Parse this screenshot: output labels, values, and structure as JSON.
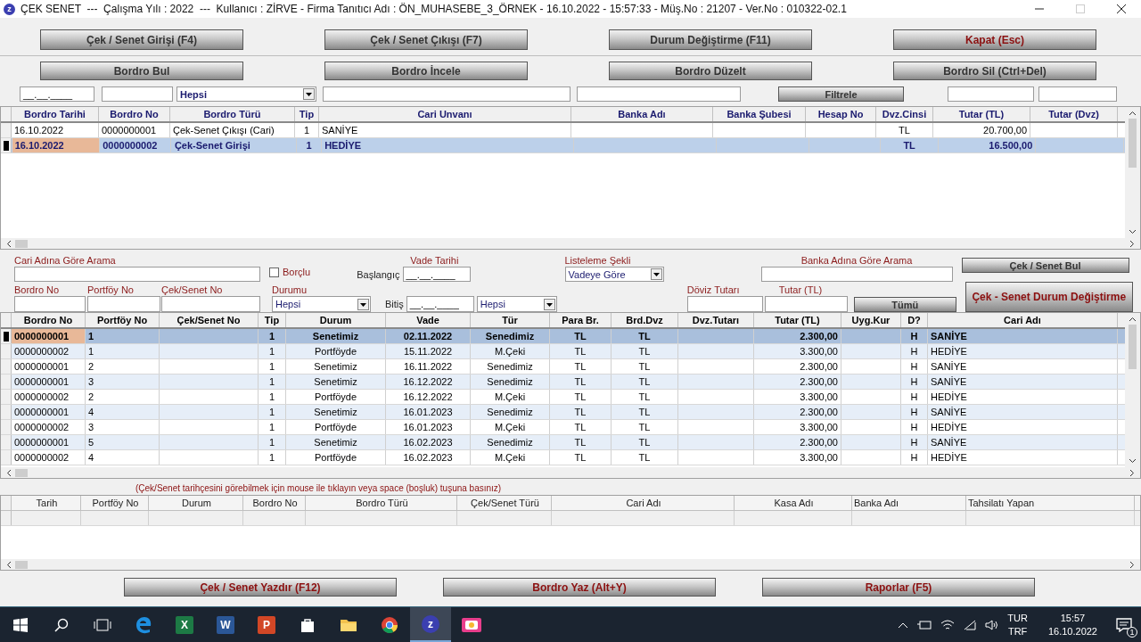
{
  "window": {
    "app_letter": "z",
    "title": "ÇEK SENET  ---  Çalışma Yılı : 2022  ---  Kullanıcı : ZİRVE - Firma Tanıtıcı Adı : ÖN_MUHASEBE_3_ÖRNEK - 16.10.2022 - 15:57:33 - Müş.No : 21207 - Ver.No : 010322-02.1"
  },
  "top_buttons": [
    {
      "label": "Çek / Senet Girişi (F4)",
      "kind": "normal"
    },
    {
      "label": "Çek / Senet Çıkışı (F7)",
      "kind": "normal"
    },
    {
      "label": "Durum Değiştirme (F11)",
      "kind": "normal"
    },
    {
      "label": "Kapat (Esc)",
      "kind": "danger"
    }
  ],
  "bordro_buttons": [
    "Bordro Bul",
    "Bordro İncele",
    "Bordro Düzelt",
    "Bordro Sil (Ctrl+Del)"
  ],
  "filter_bar": {
    "date_value": "__.__.____",
    "type_value": "Hepsi",
    "filter_button": "Filtrele"
  },
  "bordro_table": {
    "columns": [
      "Bordro Tarihi",
      "Bordro No",
      "Bordro Türü",
      "Tip",
      "Cari Unvanı",
      "Banka Adı",
      "Banka Şubesi",
      "Hesap No",
      "Dvz.Cinsi",
      "Tutar (TL)",
      "Tutar (Dvz)"
    ],
    "rows": [
      {
        "selected": false,
        "cells": [
          "16.10.2022",
          "0000000001",
          "Çek-Senet Çıkışı (Cari)",
          "1",
          "SANİYE",
          "",
          "",
          "",
          "TL",
          "20.700,00",
          ""
        ]
      },
      {
        "selected": true,
        "cells": [
          "16.10.2022",
          "0000000002",
          "Çek-Senet Girişi",
          "1",
          "HEDİYE",
          "",
          "",
          "",
          "TL",
          "16.500,00",
          ""
        ]
      }
    ]
  },
  "search": {
    "cari_label": "Cari Adına Göre Arama",
    "borclu_label": "Borçlu",
    "borclu_checked": false,
    "vade_label": "Vade Tarihi",
    "start_label": "Başlangıç",
    "start_value": "__.__.____",
    "end_label": "Bitiş",
    "end_value": "__.__.____",
    "end_select": "Hepsi",
    "listing_label": "Listeleme Şekli",
    "listing_value": "Vadeye Göre",
    "bank_label": "Banka Adına Göre Arama",
    "find_button": "Çek / Senet Bul",
    "bordro_no_label": "Bordro No",
    "portfoy_label": "Portföy No",
    "cek_no_label": "Çek/Senet No",
    "status_label": "Durumu",
    "status_value": "Hepsi",
    "doviz_label": "Döviz Tutarı",
    "tutar_label": "Tutar (TL)",
    "all_button": "Tümü",
    "change_button": "Çek - Senet Durum Değiştirme"
  },
  "cek_table": {
    "columns": [
      "Bordro No",
      "Portföy No",
      "Çek/Senet No",
      "Tip",
      "Durum",
      "Vade",
      "Tür",
      "Para Br.",
      "Brd.Dvz",
      "Dvz.Tutarı",
      "Tutar (TL)",
      "Uyg.Kur",
      "D?",
      "Cari Adı"
    ],
    "rows": [
      {
        "selected": true,
        "cells": [
          "0000000001",
          "1",
          "",
          "1",
          "Senetimiz",
          "02.11.2022",
          "Senedimiz",
          "TL",
          "TL",
          "",
          "2.300,00",
          "",
          "H",
          "SANİYE"
        ]
      },
      {
        "selected": false,
        "cells": [
          "0000000002",
          "1",
          "",
          "1",
          "Portföyde",
          "15.11.2022",
          "M.Çeki",
          "TL",
          "TL",
          "",
          "3.300,00",
          "",
          "H",
          "HEDİYE"
        ]
      },
      {
        "selected": false,
        "cells": [
          "0000000001",
          "2",
          "",
          "1",
          "Senetimiz",
          "16.11.2022",
          "Senedimiz",
          "TL",
          "TL",
          "",
          "2.300,00",
          "",
          "H",
          "SANİYE"
        ]
      },
      {
        "selected": false,
        "cells": [
          "0000000001",
          "3",
          "",
          "1",
          "Senetimiz",
          "16.12.2022",
          "Senedimiz",
          "TL",
          "TL",
          "",
          "2.300,00",
          "",
          "H",
          "SANİYE"
        ]
      },
      {
        "selected": false,
        "cells": [
          "0000000002",
          "2",
          "",
          "1",
          "Portföyde",
          "16.12.2022",
          "M.Çeki",
          "TL",
          "TL",
          "",
          "3.300,00",
          "",
          "H",
          "HEDİYE"
        ]
      },
      {
        "selected": false,
        "cells": [
          "0000000001",
          "4",
          "",
          "1",
          "Senetimiz",
          "16.01.2023",
          "Senedimiz",
          "TL",
          "TL",
          "",
          "2.300,00",
          "",
          "H",
          "SANİYE"
        ]
      },
      {
        "selected": false,
        "cells": [
          "0000000002",
          "3",
          "",
          "1",
          "Portföyde",
          "16.01.2023",
          "M.Çeki",
          "TL",
          "TL",
          "",
          "3.300,00",
          "",
          "H",
          "HEDİYE"
        ]
      },
      {
        "selected": false,
        "cells": [
          "0000000001",
          "5",
          "",
          "1",
          "Senetimiz",
          "16.02.2023",
          "Senedimiz",
          "TL",
          "TL",
          "",
          "2.300,00",
          "",
          "H",
          "SANİYE"
        ]
      },
      {
        "selected": false,
        "cells": [
          "0000000002",
          "4",
          "",
          "1",
          "Portföyde",
          "16.02.2023",
          "M.Çeki",
          "TL",
          "TL",
          "",
          "3.300,00",
          "",
          "H",
          "HEDİYE"
        ]
      }
    ]
  },
  "history_hint": "(Çek/Senet tarihçesini görebilmek için mouse ile tıklayın veya space (boşluk) tuşuna basınız)",
  "history_table": {
    "columns": [
      "Tarih",
      "Portföy No",
      "Durum",
      "Bordro No",
      "Bordro Türü",
      "Çek/Senet Türü",
      "Cari Adı",
      "Kasa Adı",
      "Banka Adı",
      "Tahsilatı Yapan"
    ]
  },
  "bottom_buttons": [
    "Çek / Senet Yazdır (F12)",
    "Bordro Yaz (Alt+Y)",
    "Raporlar (F5)"
  ],
  "taskbar": {
    "apps": [
      {
        "kind": "start"
      },
      {
        "kind": "search"
      },
      {
        "kind": "taskview"
      },
      {
        "kind": "edge"
      },
      {
        "kind": "excel",
        "letter": "X"
      },
      {
        "kind": "word",
        "letter": "W"
      },
      {
        "kind": "powerpoint",
        "letter": "P"
      },
      {
        "kind": "store"
      },
      {
        "kind": "explorer"
      },
      {
        "kind": "chrome"
      },
      {
        "kind": "zirve",
        "letter": "z",
        "selected": true
      },
      {
        "kind": "media"
      }
    ],
    "language": "TUR",
    "layout": "TRF",
    "time": "15:57",
    "date": "16.10.2022",
    "notifications": "1"
  }
}
